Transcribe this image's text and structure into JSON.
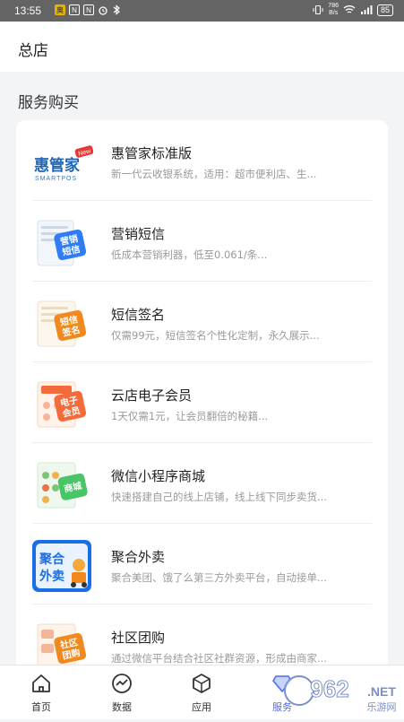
{
  "status_bar": {
    "time": "13:55",
    "notif_badges": [
      "奥",
      "N",
      "N"
    ],
    "net_speed_value": "786",
    "net_speed_unit": "B/s",
    "battery": "85"
  },
  "header": {
    "title": "总店"
  },
  "section": {
    "title": "服务购买"
  },
  "services": [
    {
      "name": "惠管家标准版",
      "desc": "新一代云收银系统，适用：超市便利店、生...",
      "thumb_text": [
        "惠管家",
        "SMARTPOS",
        "New"
      ]
    },
    {
      "name": "营销短信",
      "desc": "低成本营销利器，低至0.061/条...",
      "thumb_text": [
        "营销",
        "短信"
      ]
    },
    {
      "name": "短信签名",
      "desc": "仅需99元，短信签名个性化定制，永久展示...",
      "thumb_text": [
        "短信",
        "签名"
      ]
    },
    {
      "name": "云店电子会员",
      "desc": "1天仅需1元，让会员翻倍的秘籍...",
      "thumb_text": [
        "电子",
        "会员"
      ]
    },
    {
      "name": "微信小程序商城",
      "desc": "快速搭建自己的线上店铺，线上线下同步卖货...",
      "thumb_text": [
        "商城"
      ]
    },
    {
      "name": "聚合外卖",
      "desc": "聚合美团、饿了么第三方外卖平台，自动接单...",
      "thumb_text": [
        "聚合",
        "外卖"
      ]
    },
    {
      "name": "社区团购",
      "desc": "通过微信平台结合社区社群资源，形成由商家...",
      "thumb_text": [
        "社区",
        "团购"
      ]
    }
  ],
  "tabbar": [
    {
      "label": "首页",
      "icon": "home-icon"
    },
    {
      "label": "数据",
      "icon": "chart-icon"
    },
    {
      "label": "应用",
      "icon": "box-icon"
    },
    {
      "label": "服务",
      "icon": "diamond-icon"
    }
  ],
  "watermark": {
    "text": "962",
    "suffix": ".NET",
    "sub": "乐游网"
  },
  "colors": {
    "accent": "#4a6cf7",
    "badge_orange": "#f18a1e",
    "badge_green": "#49c467",
    "badge_blue": "#2f7cf6"
  }
}
